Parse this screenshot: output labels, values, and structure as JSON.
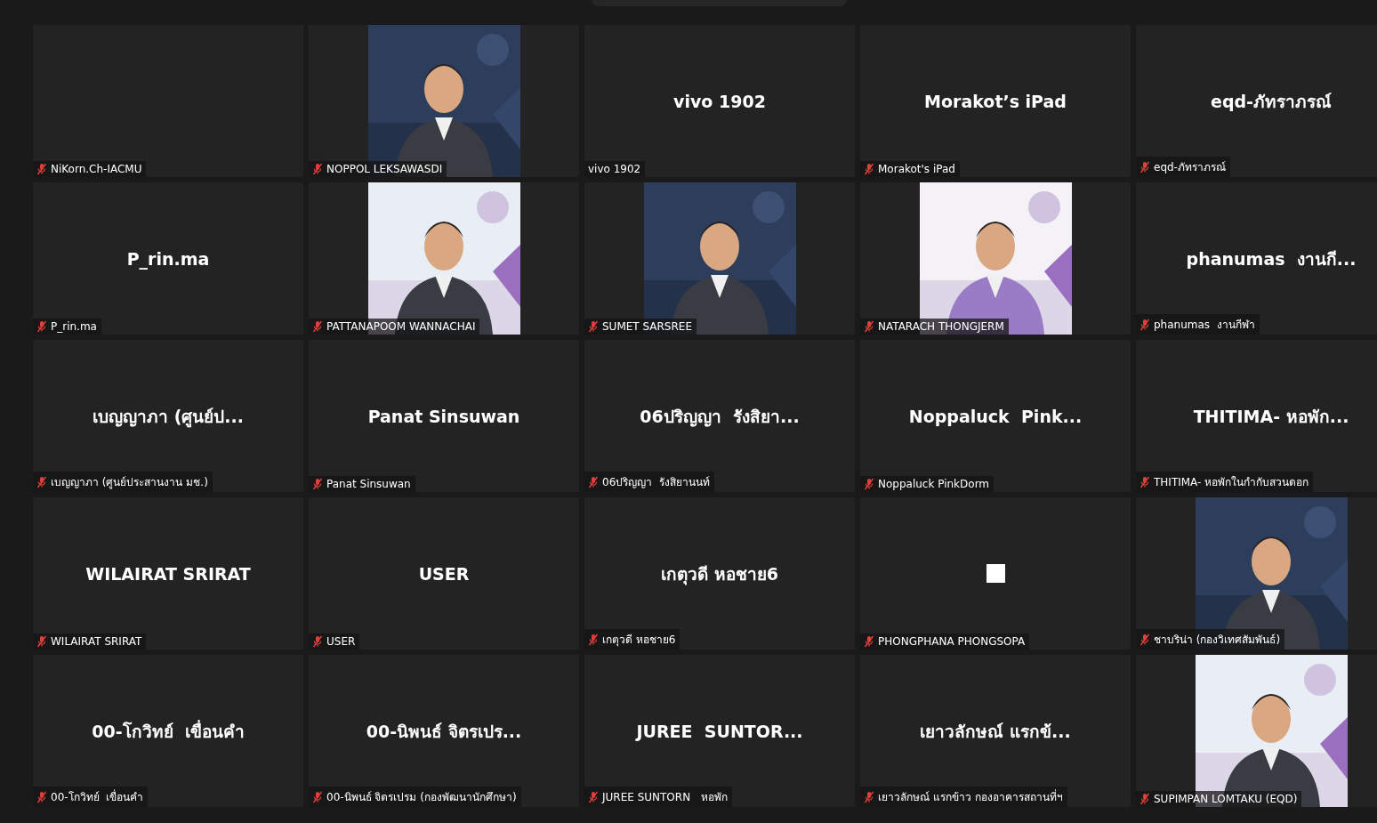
{
  "tiles": [
    {
      "kind": "blank",
      "label": "NiKorn.Ch-IACMU",
      "muted": true
    },
    {
      "kind": "picture",
      "label": "NOPPOL LEKSAWASDI",
      "muted": true
    },
    {
      "kind": "name",
      "display": "vivo 1902",
      "label": "vivo 1902",
      "muted": false
    },
    {
      "kind": "name",
      "display": "Morakot’s iPad",
      "label": "Morakot's iPad",
      "muted": true
    },
    {
      "kind": "name",
      "display": "eqd-ภัทราภรณ์",
      "label": "eqd-ภัทราภรณ์",
      "muted": true
    },
    {
      "kind": "name",
      "display": "P_rin.ma",
      "label": "P_rin.ma",
      "muted": true
    },
    {
      "kind": "picture",
      "label": "PATTANAPOOM WANNACHAI",
      "muted": true
    },
    {
      "kind": "picture",
      "label": "SUMET SARSREE",
      "muted": true
    },
    {
      "kind": "picture",
      "label": "NATARACH THONGJERM",
      "muted": true
    },
    {
      "kind": "name",
      "display": "phanumas  งานกี...",
      "label": "phanumas  งานกีฬา",
      "muted": true
    },
    {
      "kind": "name",
      "display": "เบญญาภา (ศูนย์ป...",
      "label": "เบญญาภา (ศูนย์ประสานงาน มช.)",
      "muted": true
    },
    {
      "kind": "name",
      "display": "Panat Sinsuwan",
      "label": "Panat Sinsuwan",
      "muted": true
    },
    {
      "kind": "name",
      "display": "06ปริญญา  รังสิยา...",
      "label": "06ปริญญา  รังสิยานนท์",
      "muted": true
    },
    {
      "kind": "name",
      "display": "Noppaluck  Pink...",
      "label": "Noppaluck PinkDorm",
      "muted": true
    },
    {
      "kind": "name",
      "display": "THITIMA- หอพัก...",
      "label": "THITIMA- หอพักในกำกับสวนดอก",
      "muted": true
    },
    {
      "kind": "name",
      "display": "WILAIRAT SRIRAT",
      "label": "WILAIRAT SRIRAT",
      "muted": true
    },
    {
      "kind": "name",
      "display": "USER",
      "label": "USER",
      "muted": true
    },
    {
      "kind": "name",
      "display": "เกตุวดี หอชาย6",
      "label": "เกตุวดี หอชาย6",
      "muted": true
    },
    {
      "kind": "square",
      "label": "PHONGPHANA PHONGSOPA",
      "muted": true
    },
    {
      "kind": "picture",
      "label": "ชาบริน่า (กองวิเทศสัมพันธ์)",
      "muted": true
    },
    {
      "kind": "name",
      "display": "00-โกวิทย์  เขื่อนคำ",
      "label": "00-โกวิทย์  เขื่อนคำ",
      "muted": true
    },
    {
      "kind": "name",
      "display": "00-นิพนธ์ จิตรเปร...",
      "label": "00-นิพนธ์ จิตรเปรม (กองพัฒนานักศึกษา)",
      "muted": true
    },
    {
      "kind": "name",
      "display": "JUREE  SUNTOR...",
      "label": "JUREE SUNTORN   หอพัก",
      "muted": true
    },
    {
      "kind": "name",
      "display": "เยาวลักษณ์ แรกข้...",
      "label": "เยาวลักษณ์ แรกข้าว กองอาคารสถานที่ฯ",
      "muted": true
    },
    {
      "kind": "picture",
      "label": "SUPIMPAN LOMTAKU (EQD)",
      "muted": true
    }
  ]
}
